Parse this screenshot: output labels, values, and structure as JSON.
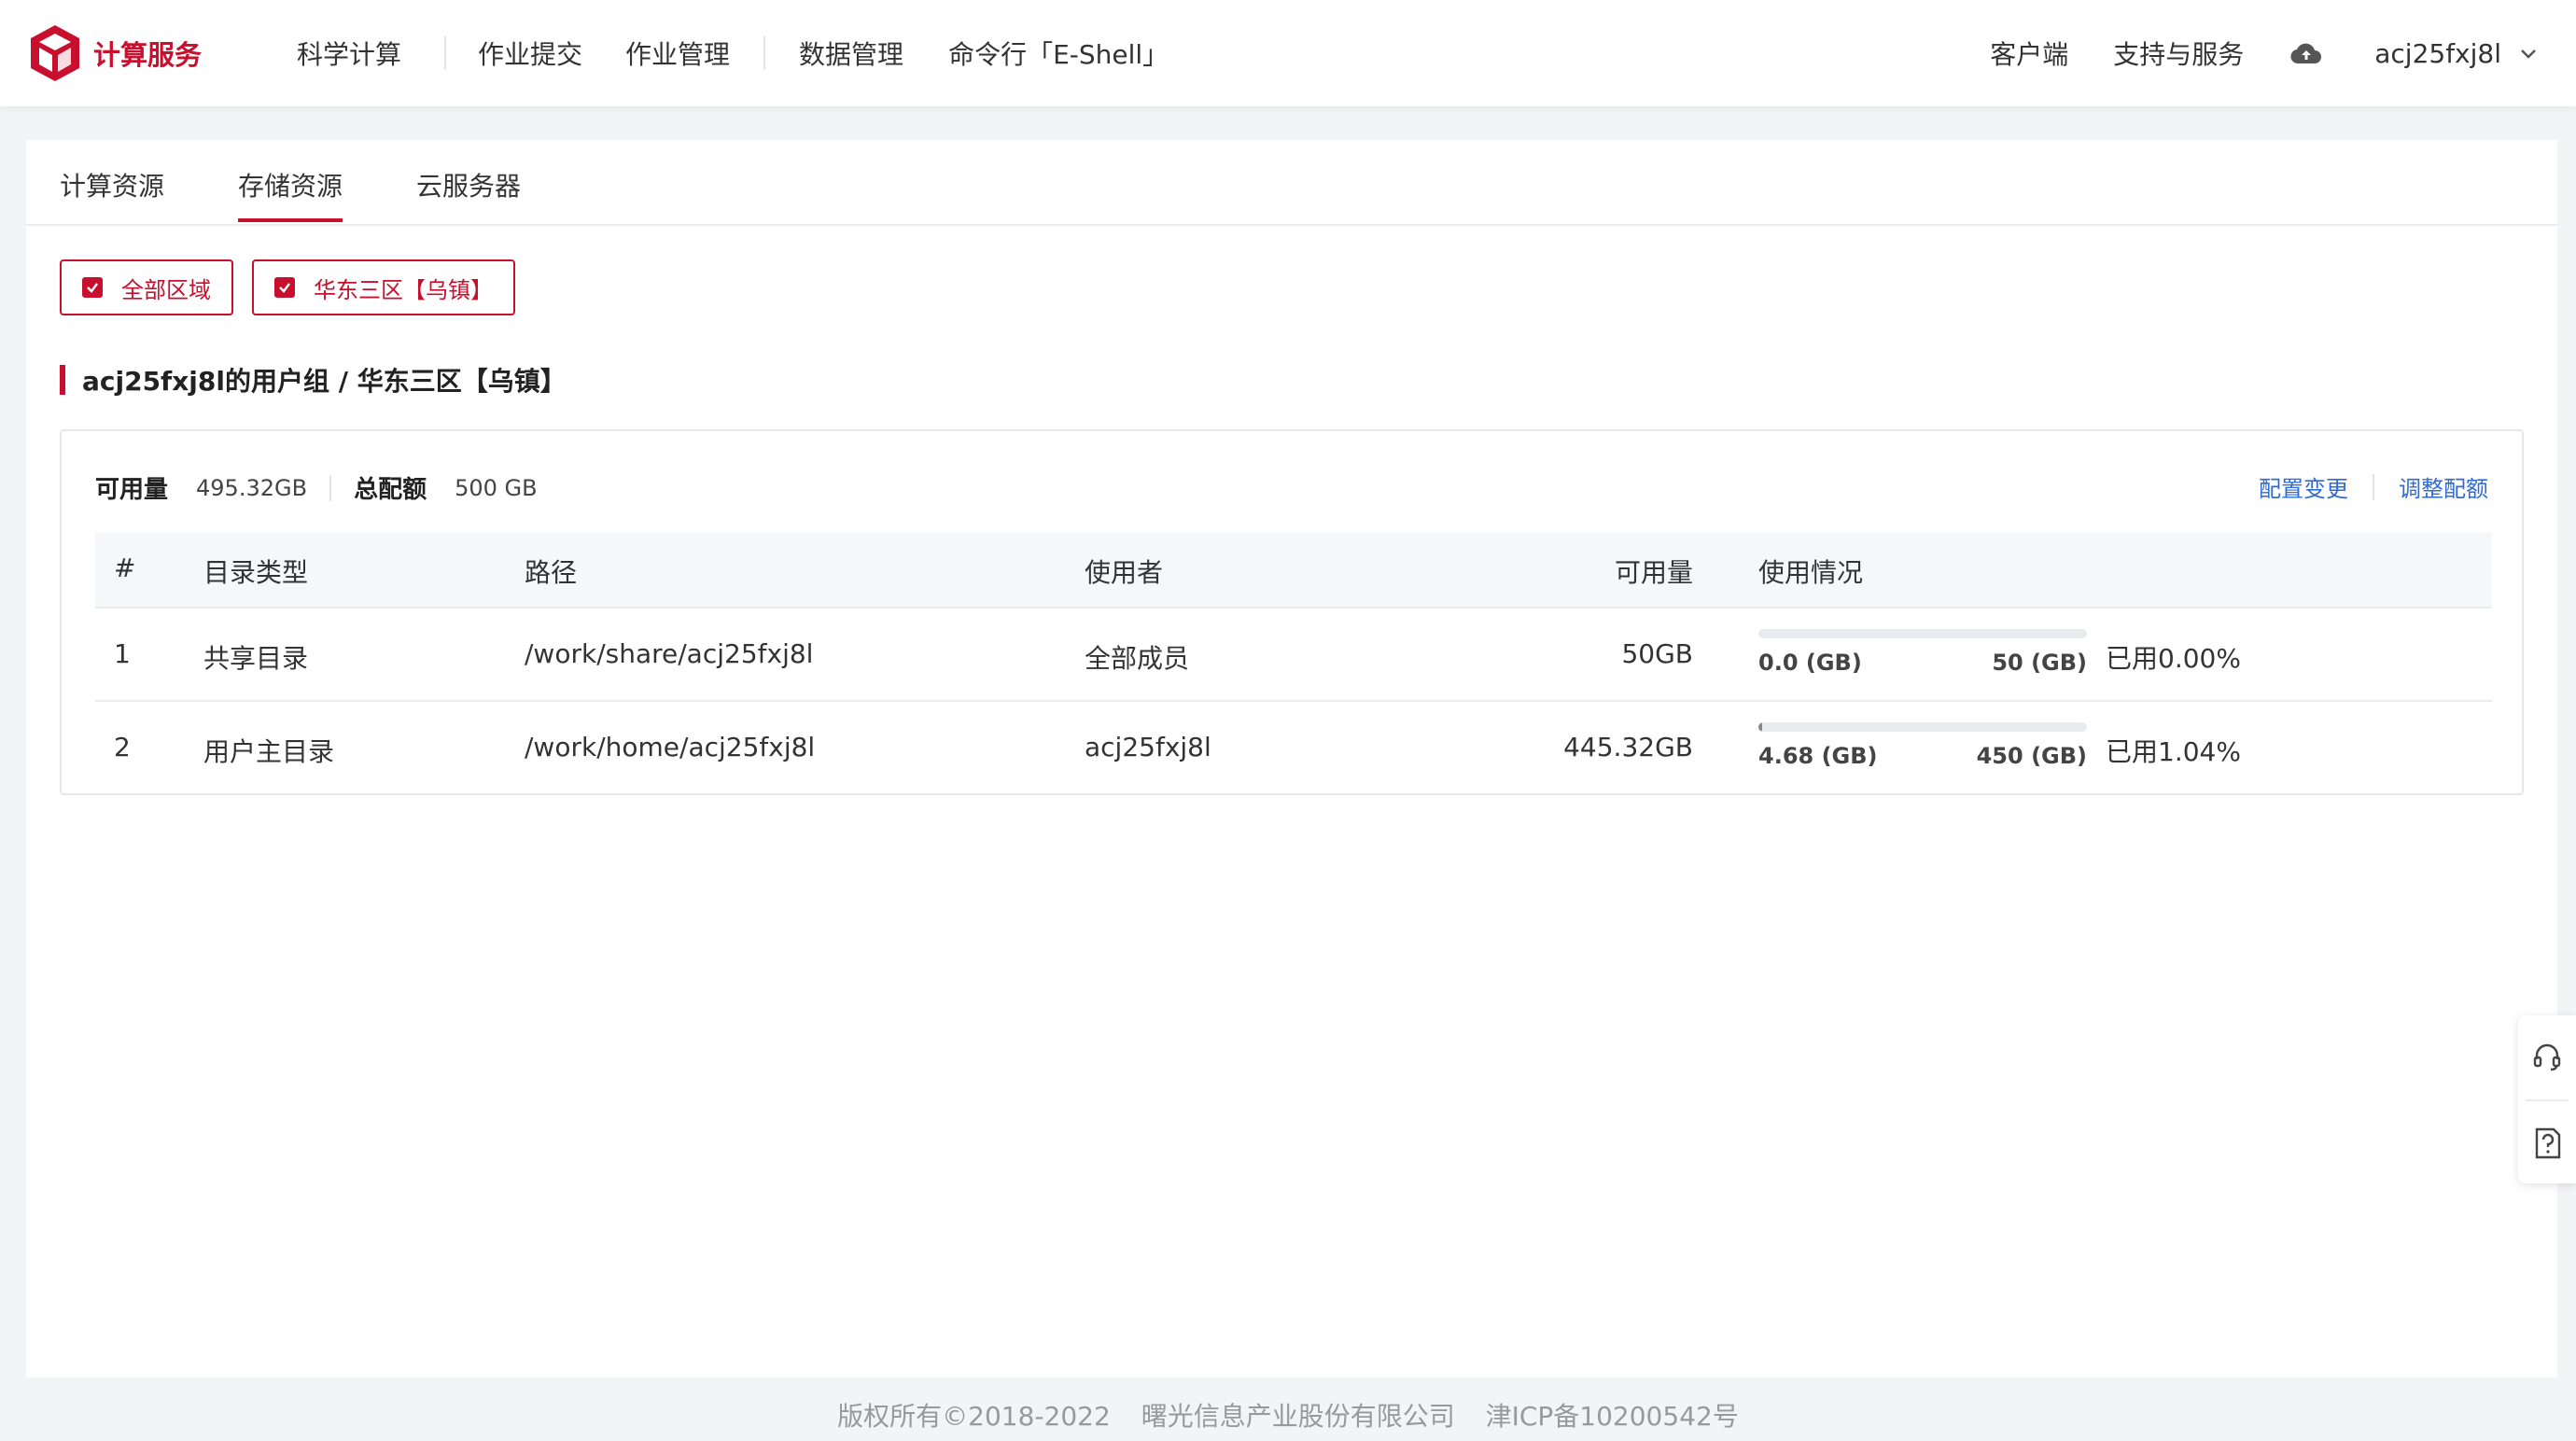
{
  "brand": {
    "name": "计算服务",
    "color": "#c8102e"
  },
  "nav": {
    "items": [
      "科学计算",
      "作业提交",
      "作业管理",
      "数据管理",
      "命令行「E-Shell」"
    ]
  },
  "header_right": {
    "client": "客户端",
    "support": "支持与服务",
    "upload_icon": "cloud-upload-icon",
    "username": "acj25fxj8l"
  },
  "tabs": [
    "计算资源",
    "存储资源",
    "云服务器"
  ],
  "active_tab": "存储资源",
  "filters": [
    "全部区域",
    "华东三区【乌镇】"
  ],
  "group_title": "acj25fxj8l的用户组 / 华东三区【乌镇】",
  "summary": {
    "available_label": "可用量",
    "available_value": "495.32GB",
    "total_label": "总配额",
    "total_value": "500 GB"
  },
  "actions": {
    "config_change": "配置变更",
    "adjust_quota": "调整配额"
  },
  "table": {
    "headers": [
      "#",
      "目录类型",
      "路径",
      "使用者",
      "可用量",
      "使用情况"
    ],
    "rows": [
      {
        "index": "1",
        "type": "共享目录",
        "path": "/work/share/acj25fxj8l",
        "user": "全部成员",
        "available": "50GB",
        "used": "0.0 (GB)",
        "total": "50 (GB)",
        "used_fraction": 0.0,
        "percent": "已用0.00%"
      },
      {
        "index": "2",
        "type": "用户主目录",
        "path": "/work/home/acj25fxj8l",
        "user": "acj25fxj8l",
        "available": "445.32GB",
        "used": "4.68 (GB)",
        "total": "450 (GB)",
        "used_fraction": 0.0104,
        "percent": "已用1.04%"
      }
    ]
  },
  "side_widget": {
    "top_icon": "headset-icon",
    "bottom_icon": "help-doc-icon"
  },
  "footer": {
    "copyright": "版权所有©2018-2022",
    "company": "曙光信息产业股份有限公司",
    "icp": "津ICP备10200542号"
  }
}
